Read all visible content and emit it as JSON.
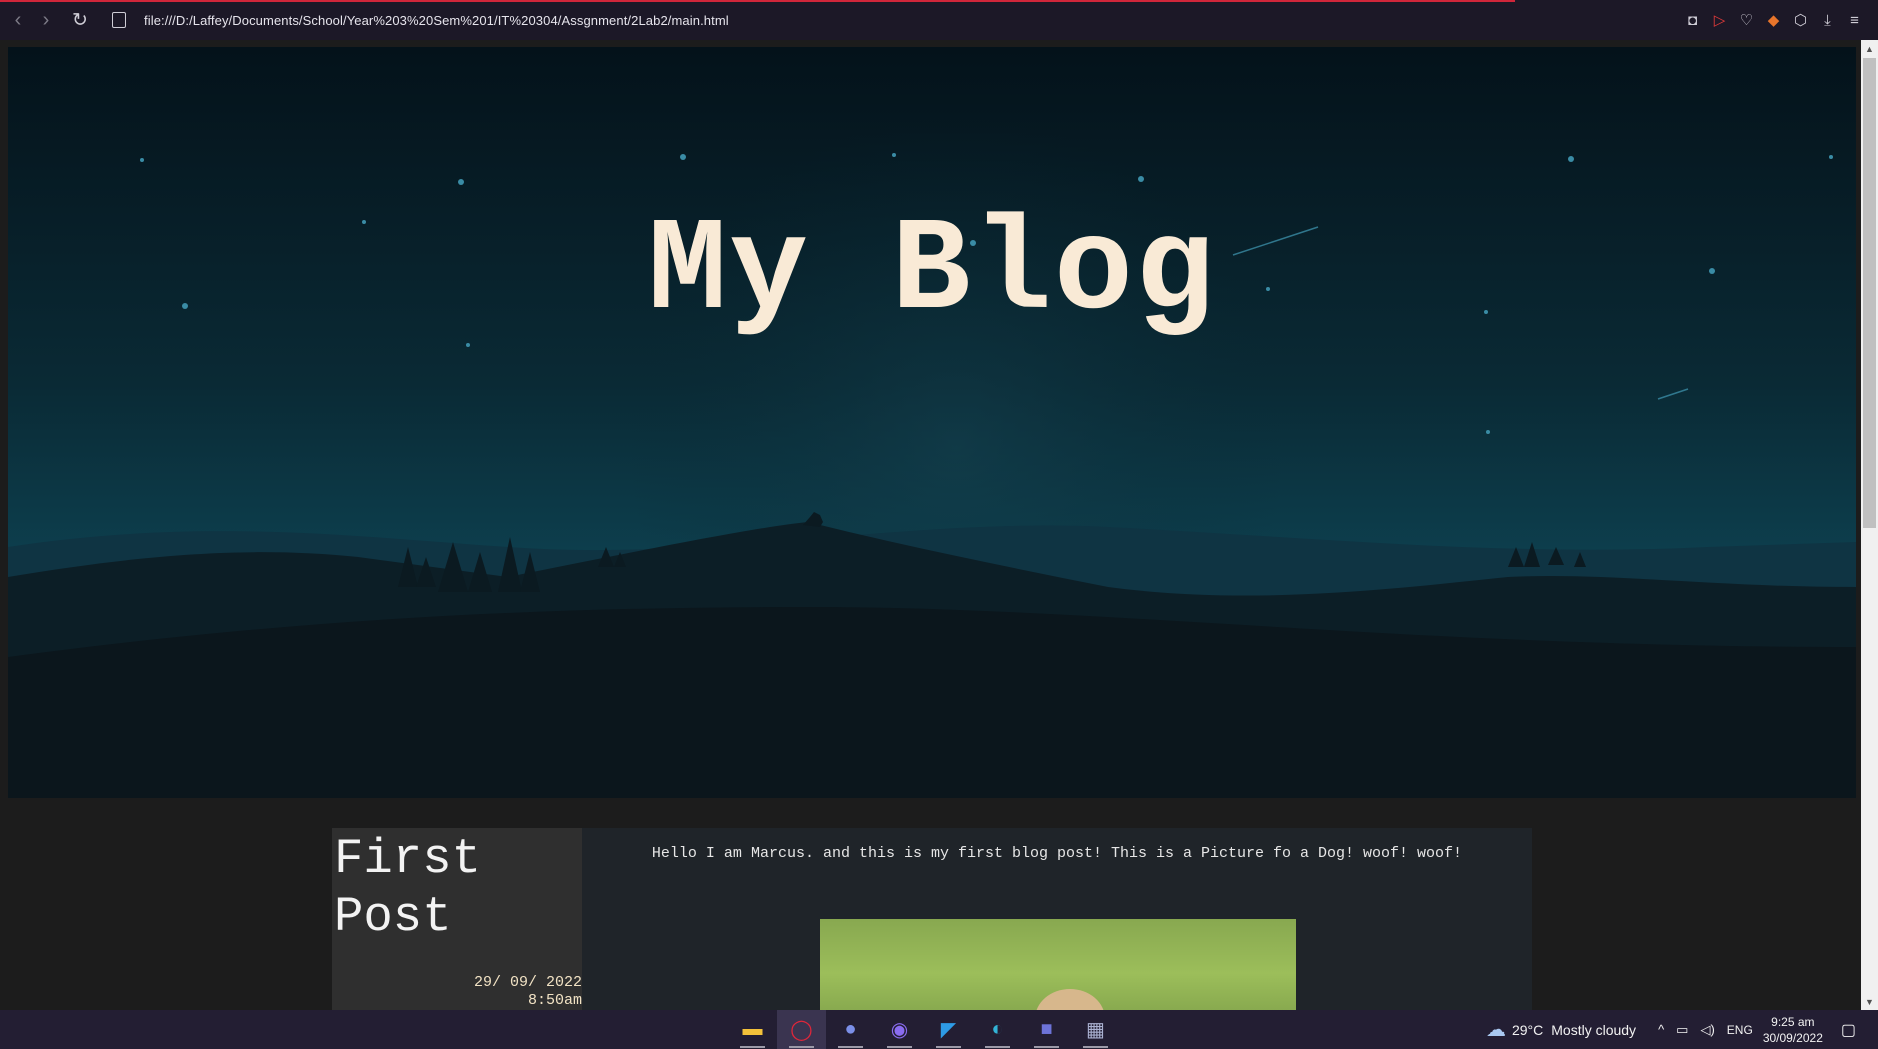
{
  "browser": {
    "url": "file:///D:/Laffey/Documents/School/Year%203%20Sem%201/IT%20304/Assgnment/2Lab2/main.html",
    "icons": [
      "back-icon",
      "forward-icon",
      "reload-icon",
      "page-icon",
      "camera-icon",
      "send-icon",
      "heart-icon",
      "wallet-icon",
      "cube-icon",
      "download-icon",
      "menu-icon"
    ]
  },
  "hero": {
    "title": "My Blog"
  },
  "post": {
    "title": "First Post",
    "date": "29/ 09/ 2022",
    "time": "8:50am",
    "text": "Hello I am Marcus. and this is my first blog post! This is a Picture fo a Dog! woof! woof!"
  },
  "taskbar": {
    "apps": [
      "file-explorer-icon",
      "opera-icon",
      "discord-icon",
      "messenger-icon",
      "vscode-icon",
      "edge-icon",
      "teams-icon",
      "calculator-icon"
    ],
    "weather_temp": "29°C",
    "weather_desc": "Mostly cloudy",
    "language": "ENG",
    "time": "9:25 am",
    "date": "30/09/2022"
  },
  "colors": {
    "title": "#f9ead6",
    "sky_top": "#04121a",
    "sky_bottom": "#0e4555",
    "taskbar": "#231e33"
  }
}
